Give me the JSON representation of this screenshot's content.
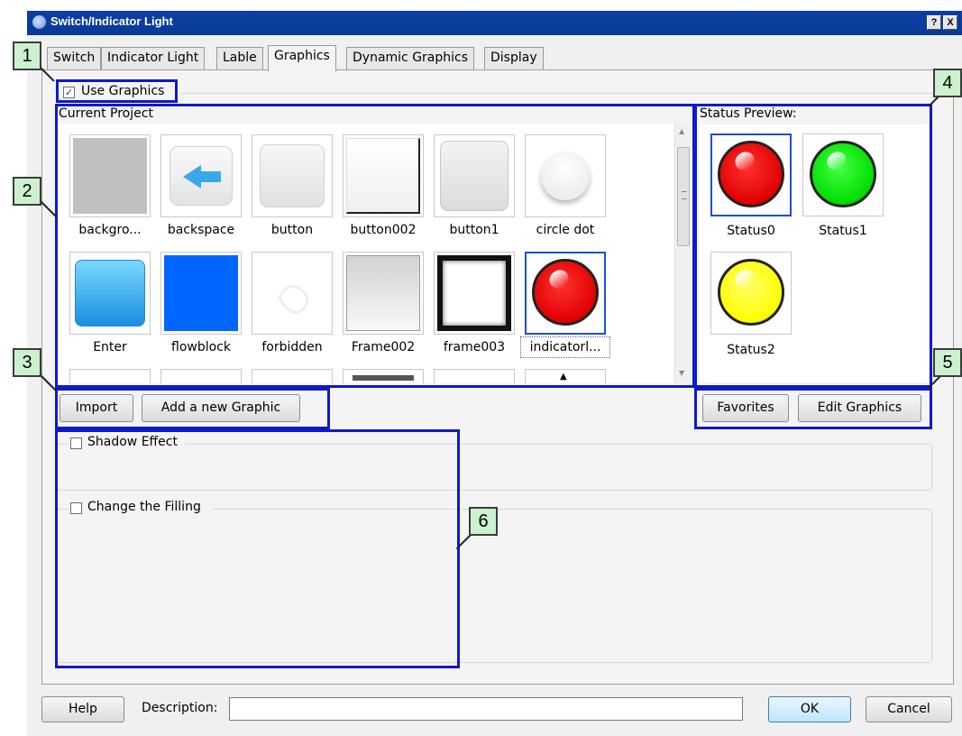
{
  "window": {
    "title": "Switch/Indicator Light",
    "help_glyph": "?",
    "close_glyph": "X"
  },
  "tabs": [
    "Switch",
    "Indicator Light",
    "Lable",
    "Graphics",
    "Dynamic Graphics",
    "Display"
  ],
  "active_tab": "Graphics",
  "use_graphics": {
    "label": "Use Graphics",
    "checked": true
  },
  "current_project": {
    "label": "Current Project"
  },
  "gallery": {
    "row1": [
      "backgro...",
      "backspace",
      "button",
      "button002",
      "button1",
      "circle dot"
    ],
    "row2": [
      "Enter",
      "flowblock",
      "forbidden",
      "Frame002",
      "frame003",
      "indicatorl..."
    ],
    "selected": "indicatorl..."
  },
  "preview": {
    "label": "Status Preview:",
    "items": [
      {
        "label": "Status0",
        "color": "#ff0000"
      },
      {
        "label": "Status1",
        "color": "#00dd00"
      },
      {
        "label": "Status2",
        "color": "#ffff00"
      }
    ]
  },
  "buttons": {
    "import": "Import",
    "add_graphic": "Add a new Graphic",
    "favorites": "Favorites",
    "edit_graphics": "Edit Graphics"
  },
  "shadow_effect": {
    "label": "Shadow Effect",
    "checked": false
  },
  "change_filling": {
    "label": "Change the Filling",
    "checked": false
  },
  "footer": {
    "help": "Help",
    "description_label": "Description:",
    "description_value": "",
    "ok": "OK",
    "cancel": "Cancel"
  },
  "callouts": [
    "1",
    "2",
    "3",
    "4",
    "5",
    "6"
  ],
  "colors": {
    "titlebar": "#0a3a96",
    "annotation": "#1019c8",
    "callout_fill": "#cdf1ce"
  }
}
